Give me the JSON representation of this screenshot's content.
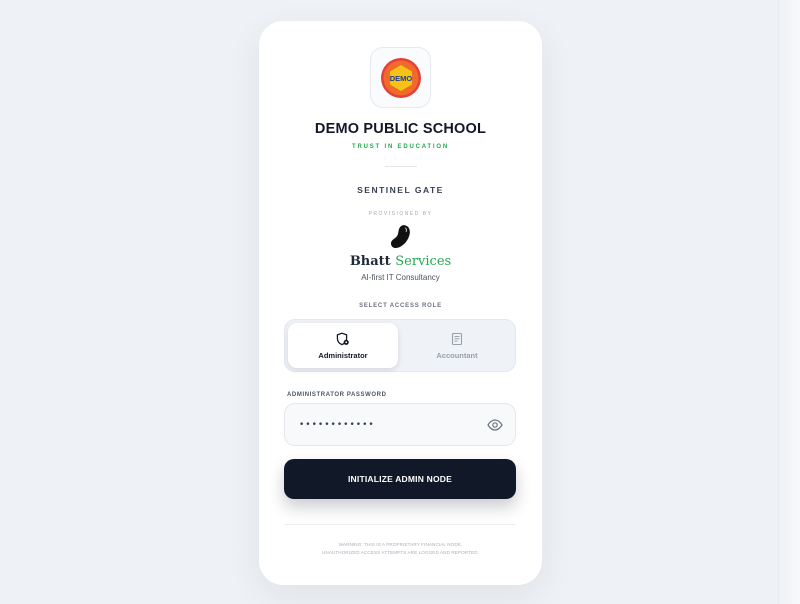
{
  "school": {
    "logo_text": "DEMO",
    "name": "DEMO PUBLIC SCHOOL",
    "tagline": "TRUST IN EDUCATION"
  },
  "gate_title": "SENTINEL GATE",
  "provider": {
    "provisioned_label": "PROVISIONED BY",
    "name_part1": "Bhatt",
    "name_part2": "Services",
    "subtitle": "AI-first IT Consultancy",
    "logo_icon": "bean-icon"
  },
  "role": {
    "label": "SELECT ACCESS ROLE",
    "options": [
      {
        "label": "Administrator",
        "icon": "shield-gear-icon",
        "active": true
      },
      {
        "label": "Accountant",
        "icon": "receipt-icon",
        "active": false
      }
    ]
  },
  "password": {
    "label": "ADMINISTRATOR PASSWORD",
    "value": "••••••••••••",
    "toggle_icon": "eye-icon"
  },
  "submit_label": "INITIALIZE ADMIN NODE",
  "warning": {
    "line1": "WARNING: THIS IS A PROPRIETARY FINANCIAL NODE.",
    "line2": "UNAUTHORIZED ACCESS ATTEMPTS ARE LOGGED AND REPORTED."
  },
  "colors": {
    "accent_green": "#22a94f",
    "primary_dark": "#111827",
    "logo_red": "#e4403b",
    "logo_yellow": "#f5c317"
  }
}
